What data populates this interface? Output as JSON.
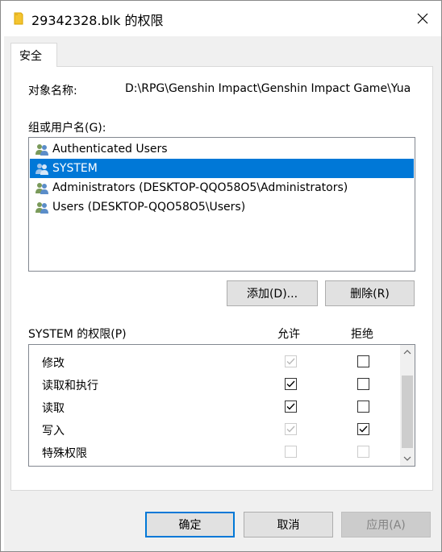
{
  "window": {
    "title": "29342328.blk 的权限",
    "folder_icon": "folder-icon",
    "close_icon": "close-icon"
  },
  "tabs": [
    {
      "label": "安全",
      "active": true
    }
  ],
  "object": {
    "label": "对象名称:",
    "value": "D:\\RPG\\Genshin Impact\\Genshin Impact Game\\Yua"
  },
  "groups": {
    "label": "组或用户名(G):",
    "items": [
      {
        "name": "Authenticated Users",
        "icon": "users-icon",
        "selected": false
      },
      {
        "name": "SYSTEM",
        "icon": "users-icon",
        "selected": true
      },
      {
        "name": "Administrators (DESKTOP-QQO58O5\\Administrators)",
        "icon": "users-icon",
        "selected": false
      },
      {
        "name": "Users (DESKTOP-QQO58O5\\Users)",
        "icon": "users-icon",
        "selected": false
      }
    ],
    "add_button": "添加(D)...",
    "remove_button": "删除(R)"
  },
  "permissions": {
    "label": "SYSTEM 的权限(P)",
    "allow_header": "允许",
    "deny_header": "拒绝",
    "rows": [
      {
        "name": "修改",
        "allow": "checked-disabled",
        "deny": "unchecked"
      },
      {
        "name": "读取和执行",
        "allow": "checked",
        "deny": "unchecked"
      },
      {
        "name": "读取",
        "allow": "checked",
        "deny": "unchecked"
      },
      {
        "name": "写入",
        "allow": "checked-disabled",
        "deny": "checked"
      },
      {
        "name": "特殊权限",
        "allow": "unchecked-disabled",
        "deny": "unchecked-disabled"
      }
    ]
  },
  "footer": {
    "ok": "确定",
    "cancel": "取消",
    "apply": "应用(A)"
  },
  "colors": {
    "selection": "#0078d7",
    "dialog_bg": "#f0f0f0",
    "button_bg": "#e1e1e1"
  }
}
